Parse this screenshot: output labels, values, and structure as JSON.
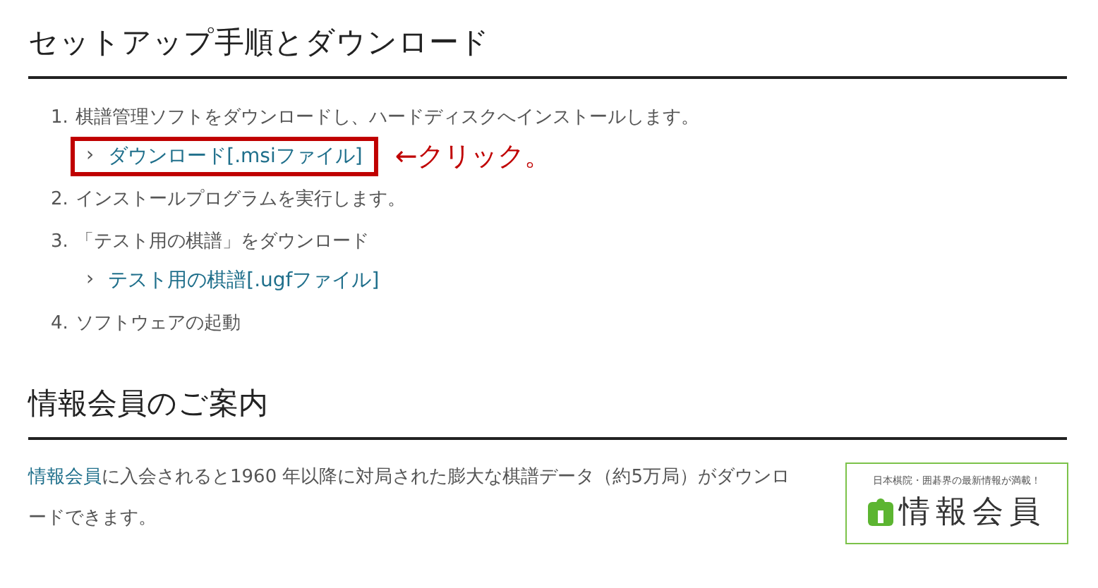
{
  "sections": [
    {
      "title": "セットアップ手順とダウンロード",
      "steps": [
        {
          "number": "1.",
          "text": "棋譜管理ソフトをダウンロードし、ハードディスクへインストールします。",
          "links": [
            {
              "chevron": "›",
              "text": "ダウンロード[.msiファイル]",
              "highlighted": true,
              "note": "←クリック。"
            }
          ]
        },
        {
          "number": "2.",
          "text": "インストールプログラムを実行します。"
        },
        {
          "number": "3.",
          "text": "「テスト用の棋譜」をダウンロード",
          "links": [
            {
              "chevron": "›",
              "text": "テスト用の棋譜[.ugfファイル]",
              "highlighted": false
            }
          ]
        },
        {
          "number": "4.",
          "text": "ソフトウェアの起動"
        }
      ]
    },
    {
      "title": "情報会員のご案内",
      "intro": {
        "link": "情報会員",
        "text": "に入会されると1960 年以降に対局された膨大な棋譜データ（約5万局）がダウンロードできます。"
      },
      "banner": {
        "tagline": "日本棋院・囲碁界の最新情報が満載！",
        "name": "情報会員"
      }
    }
  ]
}
